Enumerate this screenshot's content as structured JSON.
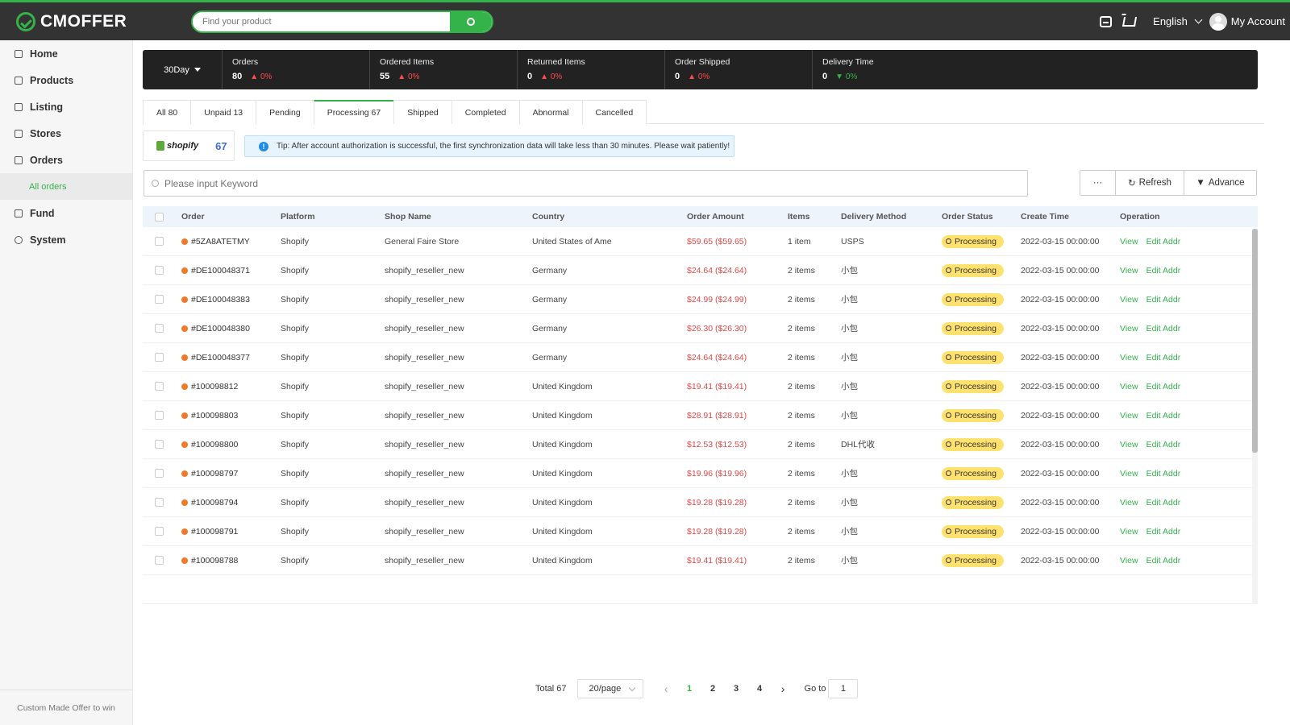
{
  "header": {
    "logo_text": "CMOFFER",
    "search_placeholder": "Find your product",
    "language": "English",
    "account": "My Account"
  },
  "sidebar": {
    "items": [
      {
        "label": "Home",
        "icon": "home-icon"
      },
      {
        "label": "Products",
        "icon": "bag-icon"
      },
      {
        "label": "Listing",
        "icon": "cart-icon"
      },
      {
        "label": "Stores",
        "icon": "store-icon"
      },
      {
        "label": "Orders",
        "icon": "bag-icon"
      },
      {
        "label": "Fund",
        "icon": "fund-icon"
      },
      {
        "label": "System",
        "icon": "gear-icon"
      }
    ],
    "sub_item": "All orders",
    "footer": "Custom Made Offer to win"
  },
  "stats": {
    "period": "30Day",
    "items": [
      {
        "label": "Orders",
        "value": "80",
        "change": "0%",
        "dir": "up"
      },
      {
        "label": "Ordered Items",
        "value": "55",
        "change": "0%",
        "dir": "up"
      },
      {
        "label": "Returned Items",
        "value": "0",
        "change": "0%",
        "dir": "up"
      },
      {
        "label": "Order Shipped",
        "value": "0",
        "change": "0%",
        "dir": "up"
      },
      {
        "label": "Delivery Time",
        "value": "0",
        "change": "0%",
        "dir": "down"
      }
    ]
  },
  "tabs": [
    "All 80",
    "Unpaid 13",
    "Pending",
    "Processing 67",
    "Shipped",
    "Completed",
    "Abnormal",
    "Cancelled"
  ],
  "active_tab": "Processing 67",
  "platform": {
    "name": "shopify",
    "count": "67"
  },
  "tip": "Tip: After account authorization is successful, the first synchronization data will take less than 30 minutes. Please wait patiently!",
  "keyword_placeholder": "Please input Keyword",
  "actions": {
    "more": "···",
    "refresh": "Refresh",
    "advance": "Advance"
  },
  "table": {
    "columns": [
      "Order",
      "Platform",
      "Shop Name",
      "Country",
      "Order Amount",
      "Items",
      "Delivery Method",
      "Order Status",
      "Create Time",
      "Operation"
    ],
    "view_label": "View",
    "edit_label": "Edit Addr",
    "rows": [
      {
        "order": "#5ZA8ATETMY",
        "platform": "Shopify",
        "shop": "General Faire Store",
        "country": "United States of Ame",
        "amount": "$59.65 ($59.65)",
        "items": "1 item",
        "delivery": "USPS",
        "status": "Processing",
        "time": "2022-03-15 00:00:00"
      },
      {
        "order": "#DE100048371",
        "platform": "Shopify",
        "shop": "shopify_reseller_new",
        "country": "Germany",
        "amount": "$24.64 ($24.64)",
        "items": "2 items",
        "delivery": "小包",
        "status": "Processing",
        "time": "2022-03-15 00:00:00"
      },
      {
        "order": "#DE100048383",
        "platform": "Shopify",
        "shop": "shopify_reseller_new",
        "country": "Germany",
        "amount": "$24.99 ($24.99)",
        "items": "2 items",
        "delivery": "小包",
        "status": "Processing",
        "time": "2022-03-15 00:00:00"
      },
      {
        "order": "#DE100048380",
        "platform": "Shopify",
        "shop": "shopify_reseller_new",
        "country": "Germany",
        "amount": "$26.30 ($26.30)",
        "items": "2 items",
        "delivery": "小包",
        "status": "Processing",
        "time": "2022-03-15 00:00:00"
      },
      {
        "order": "#DE100048377",
        "platform": "Shopify",
        "shop": "shopify_reseller_new",
        "country": "Germany",
        "amount": "$24.64 ($24.64)",
        "items": "2 items",
        "delivery": "小包",
        "status": "Processing",
        "time": "2022-03-15 00:00:00"
      },
      {
        "order": "#100098812",
        "platform": "Shopify",
        "shop": "shopify_reseller_new",
        "country": "United Kingdom",
        "amount": "$19.41 ($19.41)",
        "items": "2 items",
        "delivery": "小包",
        "status": "Processing",
        "time": "2022-03-15 00:00:00"
      },
      {
        "order": "#100098803",
        "platform": "Shopify",
        "shop": "shopify_reseller_new",
        "country": "United Kingdom",
        "amount": "$28.91 ($28.91)",
        "items": "2 items",
        "delivery": "小包",
        "status": "Processing",
        "time": "2022-03-15 00:00:00"
      },
      {
        "order": "#100098800",
        "platform": "Shopify",
        "shop": "shopify_reseller_new",
        "country": "United Kingdom",
        "amount": "$12.53 ($12.53)",
        "items": "2 items",
        "delivery": "DHL代收",
        "status": "Processing",
        "time": "2022-03-15 00:00:00"
      },
      {
        "order": "#100098797",
        "platform": "Shopify",
        "shop": "shopify_reseller_new",
        "country": "United Kingdom",
        "amount": "$19.96 ($19.96)",
        "items": "2 items",
        "delivery": "小包",
        "status": "Processing",
        "time": "2022-03-15 00:00:00"
      },
      {
        "order": "#100098794",
        "platform": "Shopify",
        "shop": "shopify_reseller_new",
        "country": "United Kingdom",
        "amount": "$19.28 ($19.28)",
        "items": "2 items",
        "delivery": "小包",
        "status": "Processing",
        "time": "2022-03-15 00:00:00"
      },
      {
        "order": "#100098791",
        "platform": "Shopify",
        "shop": "shopify_reseller_new",
        "country": "United Kingdom",
        "amount": "$19.28 ($19.28)",
        "items": "2 items",
        "delivery": "小包",
        "status": "Processing",
        "time": "2022-03-15 00:00:00"
      },
      {
        "order": "#100098788",
        "platform": "Shopify",
        "shop": "shopify_reseller_new",
        "country": "United Kingdom",
        "amount": "$19.41 ($19.41)",
        "items": "2 items",
        "delivery": "小包",
        "status": "Processing",
        "time": "2022-03-15 00:00:00"
      }
    ]
  },
  "pagination": {
    "total": "Total 67",
    "page_size": "20/page",
    "pages": [
      "1",
      "2",
      "3",
      "4"
    ],
    "current": "1",
    "goto_label": "Go to",
    "goto_value": "1"
  },
  "colors": {
    "accent": "#33b34a",
    "topbar": "#333333",
    "stats_bg": "#222222",
    "badge": "#ffe26e",
    "amount": "#e04848"
  }
}
